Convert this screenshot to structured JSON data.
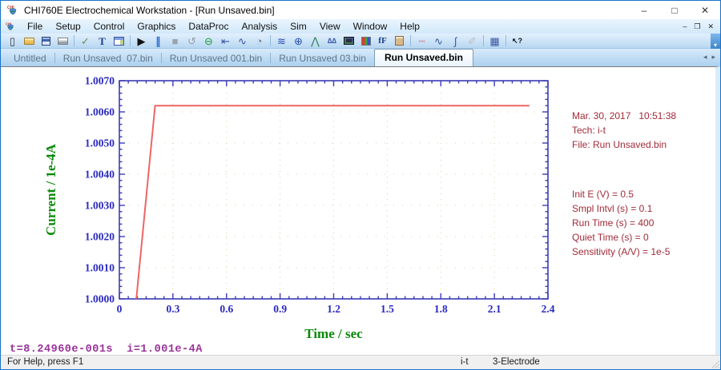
{
  "window": {
    "title": "CHI760E Electrochemical Workstation - [Run Unsaved.bin]",
    "controls": {
      "minimize": "–",
      "maximize": "□",
      "close": "✕"
    },
    "mdi_controls": {
      "minimize": "–",
      "restore": "❐",
      "close": "✕"
    }
  },
  "menu": {
    "items": [
      "File",
      "Setup",
      "Control",
      "Graphics",
      "DataProc",
      "Analysis",
      "Sim",
      "View",
      "Window",
      "Help"
    ]
  },
  "toolbar": {
    "overflow": "▾",
    "items": [
      {
        "name": "new-file",
        "glyph": "▯",
        "color": "#333"
      },
      {
        "name": "open-file",
        "css": "folder"
      },
      {
        "name": "save-file",
        "css": "floppy"
      },
      {
        "name": "print",
        "css": "printer"
      },
      {
        "sep": true
      },
      {
        "name": "system-setup",
        "glyph": "✓",
        "color": "#6f8a4e"
      },
      {
        "name": "text-tool",
        "glyph": "T",
        "color": "#1b3f8f",
        "style": "serif"
      },
      {
        "name": "cell-window",
        "css": "window"
      },
      {
        "sep": true
      },
      {
        "name": "run-experiment",
        "glyph": "▶",
        "color": "#111"
      },
      {
        "name": "pause-experiment",
        "glyph": "∥",
        "color": "#2f6fd0",
        "style": "bold"
      },
      {
        "name": "stop-experiment",
        "glyph": "■",
        "color": "#9aa3ac"
      },
      {
        "name": "reverse-scan",
        "glyph": "↺",
        "color": "#9aa3ac"
      },
      {
        "name": "zero-current",
        "glyph": "⊖",
        "color": "#1f9d3a"
      },
      {
        "name": "ir-compensation",
        "glyph": "⇤",
        "color": "#3a55a5"
      },
      {
        "name": "filter-setting",
        "glyph": "∿",
        "color": "#3a55a5"
      },
      {
        "name": "rotating-electrode",
        "glyph": "◔",
        "color": "#6d7b8a"
      },
      {
        "sep": true
      },
      {
        "name": "present-data-plot",
        "glyph": "≋",
        "color": "#2a4fae"
      },
      {
        "name": "zoom-tool",
        "glyph": "⊕",
        "color": "#2a4fae"
      },
      {
        "name": "peak-definition",
        "glyph": "⋀",
        "color": "#2a7f4f"
      },
      {
        "name": "multi-peak",
        "glyph": "∆∆",
        "color": "#3a55a5",
        "style": "small"
      },
      {
        "name": "cell-monitor",
        "css": "monitor"
      },
      {
        "name": "color-legend",
        "css": "rgb"
      },
      {
        "name": "font-settings",
        "glyph": "fF",
        "color": "#1b3f8f",
        "style": "serif-small"
      },
      {
        "name": "copy-to-clipboard",
        "css": "clipboard"
      },
      {
        "sep": true
      },
      {
        "name": "data-smoothing",
        "glyph": "┉",
        "color": "#cf8f9f"
      },
      {
        "name": "derivative",
        "glyph": "∿",
        "color": "#3a55a5"
      },
      {
        "name": "integration",
        "glyph": "∫",
        "color": "#3a55a5"
      },
      {
        "name": "baseline-correction",
        "glyph": "✐",
        "color": "#b9c0c8"
      },
      {
        "sep": true
      },
      {
        "name": "data-listing",
        "glyph": "▦",
        "color": "#3a55a5"
      },
      {
        "sep": true
      },
      {
        "name": "context-help",
        "glyph": "↖?",
        "color": "#111",
        "style": "small"
      }
    ]
  },
  "tabs": {
    "items": [
      "Untitled",
      "Run Unsaved  07.bin",
      "Run Unsaved 001.bin",
      "Run Unsaved 03.bin",
      "Run Unsaved.bin"
    ],
    "active": "Run Unsaved.bin",
    "scroll_left": "◂",
    "scroll_right": "▸"
  },
  "info_panel": {
    "color": "#a12b38",
    "header_lines": [
      "Mar. 30, 2017   10:51:38",
      "Tech: i-t",
      "File: Run Unsaved.bin"
    ],
    "param_lines": [
      "Init E (V) = 0.5",
      "Smpl Intvl (s) = 0.1",
      "Run Time (s) = 400",
      "Quiet Time (s) = 0",
      "Sensitivity (A/V) = 1e-5"
    ]
  },
  "readout": {
    "text": "t=8.24960e-001s  i=1.001e-4A",
    "color": "#993399"
  },
  "status_bar": {
    "help_text": "For Help, press F1",
    "tech": "i-t",
    "electrode": "3-Electrode"
  },
  "chart_data": {
    "type": "line",
    "title": "",
    "xlabel": "Time / sec",
    "ylabel": "Current / 1e-4A",
    "xlim": [
      0,
      2.4
    ],
    "ylim": [
      1.0,
      1.007
    ],
    "x_major_ticks": [
      0,
      0.3,
      0.6,
      0.9,
      1.2,
      1.5,
      1.8,
      2.1,
      2.4
    ],
    "x_minor_step": 0.05,
    "y_major_ticks": [
      1.0,
      1.001,
      1.002,
      1.003,
      1.004,
      1.005,
      1.006,
      1.007
    ],
    "y_minor_step": 0.0002,
    "grid": "dotted",
    "legend": "none",
    "axis_color": "#3a3ab8",
    "tick_label_color": "#2a2ac0",
    "axis_title_color": "#0a8a0a",
    "grid_color": "#d2d2a8",
    "line_color": "#ee6565",
    "series": [
      {
        "name": "i-t curve",
        "points": [
          [
            0.095,
            1.0
          ],
          [
            0.2,
            1.0062
          ],
          [
            2.296,
            1.0062
          ]
        ]
      }
    ]
  }
}
